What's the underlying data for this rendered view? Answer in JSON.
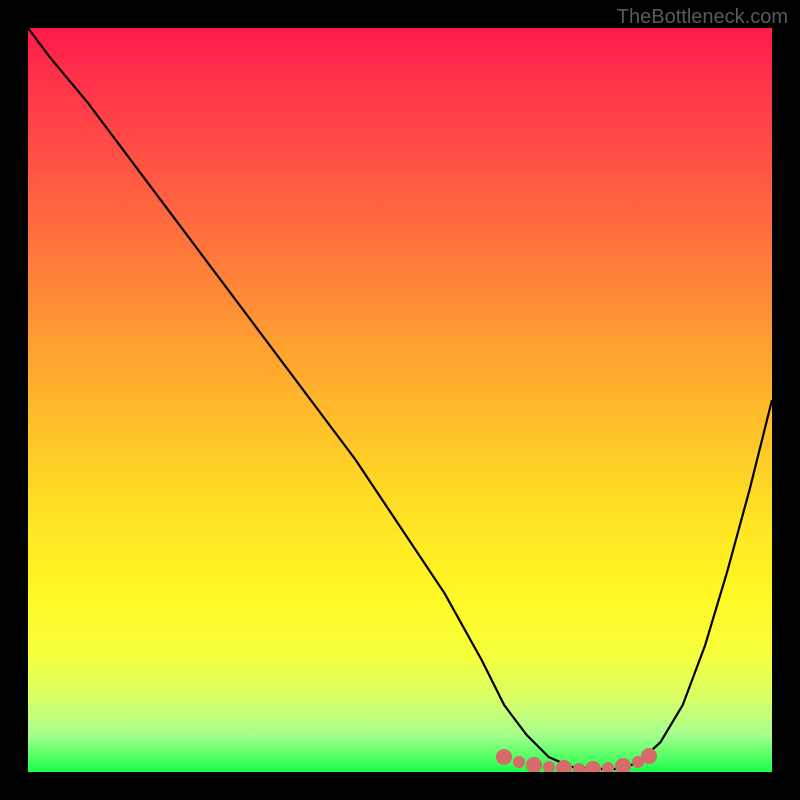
{
  "watermark": "TheBottleneck.com",
  "chart_data": {
    "type": "line",
    "title": "",
    "xlabel": "",
    "ylabel": "",
    "xlim": [
      0,
      100
    ],
    "ylim": [
      0,
      100
    ],
    "grid": false,
    "legend": false,
    "background_gradient": {
      "top": "#ff1a4a",
      "upper_mid": "#ff8a36",
      "mid": "#ffe324",
      "lower_mid": "#f6ff3a",
      "bottom": "#1aff4a"
    },
    "series": [
      {
        "name": "bottleneck-curve",
        "color": "#000000",
        "x": [
          0,
          3,
          8,
          14,
          20,
          26,
          32,
          38,
          44,
          50,
          56,
          61,
          64,
          67,
          70,
          73,
          76,
          79,
          82,
          85,
          88,
          91,
          94,
          97,
          100
        ],
        "y": [
          100,
          96,
          90,
          82,
          74,
          66,
          58,
          50,
          42,
          33,
          24,
          15,
          9,
          5,
          2,
          0.7,
          0.4,
          0.4,
          1.2,
          4,
          9,
          17,
          27,
          38,
          50
        ]
      }
    ],
    "markers": {
      "name": "optimal-zone",
      "color": "#d66b6b",
      "points": [
        {
          "x": 64,
          "y": 2.0
        },
        {
          "x": 66,
          "y": 1.4
        },
        {
          "x": 68,
          "y": 1.0
        },
        {
          "x": 70,
          "y": 0.7
        },
        {
          "x": 72,
          "y": 0.5
        },
        {
          "x": 74,
          "y": 0.4
        },
        {
          "x": 76,
          "y": 0.4
        },
        {
          "x": 78,
          "y": 0.5
        },
        {
          "x": 80,
          "y": 0.8
        },
        {
          "x": 82,
          "y": 1.4
        },
        {
          "x": 83.5,
          "y": 2.2
        }
      ]
    }
  }
}
